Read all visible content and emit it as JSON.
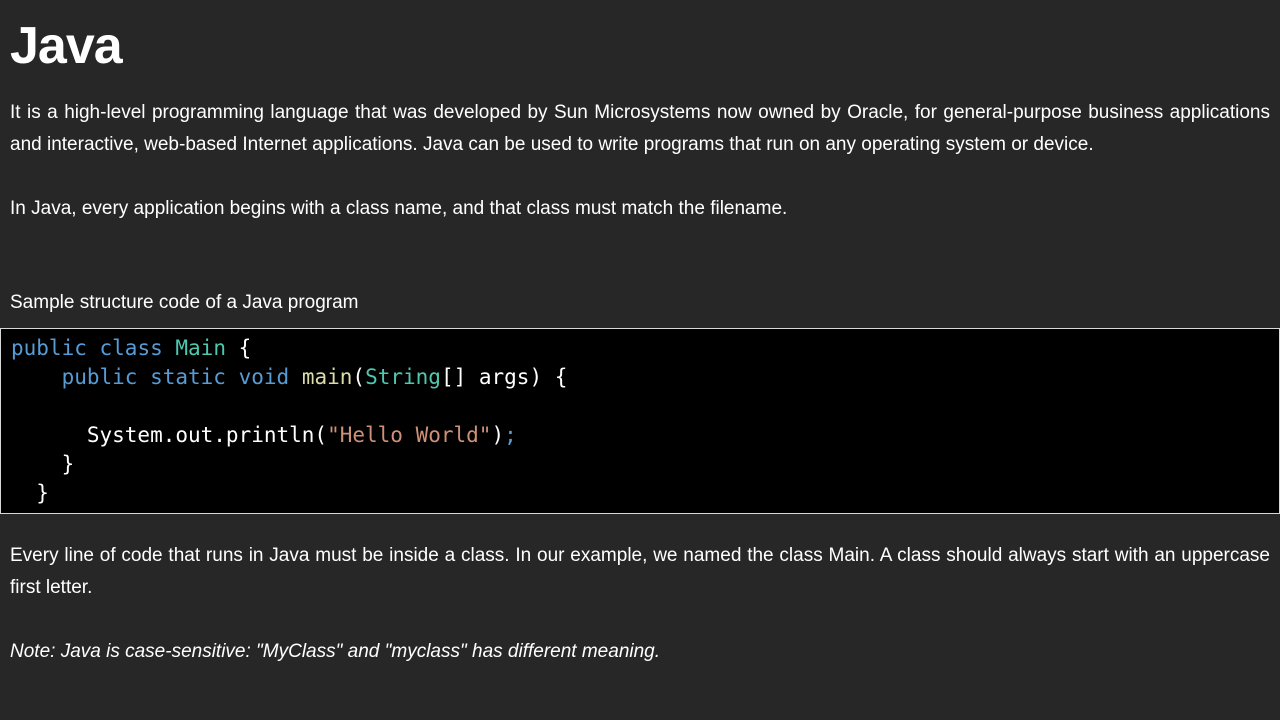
{
  "page_title": "Java",
  "intro_paragraph": "It is a high-level programming language that was developed by Sun Microsystems now owned by Oracle, for general-purpose business applications and interactive, web-based Internet applications. Java can be used to write programs that run on any operating system or device.",
  "class_paragraph": "In Java, every application begins with a class name, and that class must match the filename.",
  "code_caption": "Sample structure code of a Java program",
  "code": {
    "line1": {
      "kw1": "public",
      "kw2": "class",
      "class_name": "Main",
      "brace": "{"
    },
    "line2": {
      "kw1": "public",
      "kw2": "static",
      "kw3": "void",
      "method": "main",
      "open": "(",
      "type": "String",
      "rest": "[] args) {"
    },
    "line3": {
      "call": "System.out.println(",
      "string": "\"Hello World\"",
      "close": ")",
      "semicolon": ";"
    },
    "line4": {
      "brace": "}"
    },
    "line5": {
      "brace": "}"
    }
  },
  "class_rule_paragraph": "Every line of code that runs in Java must be inside a class. In our example, we named the class Main. A class should always start with an uppercase first letter.",
  "note": "Note: Java is case-sensitive: \"MyClass\" and \"myclass\" has different meaning."
}
